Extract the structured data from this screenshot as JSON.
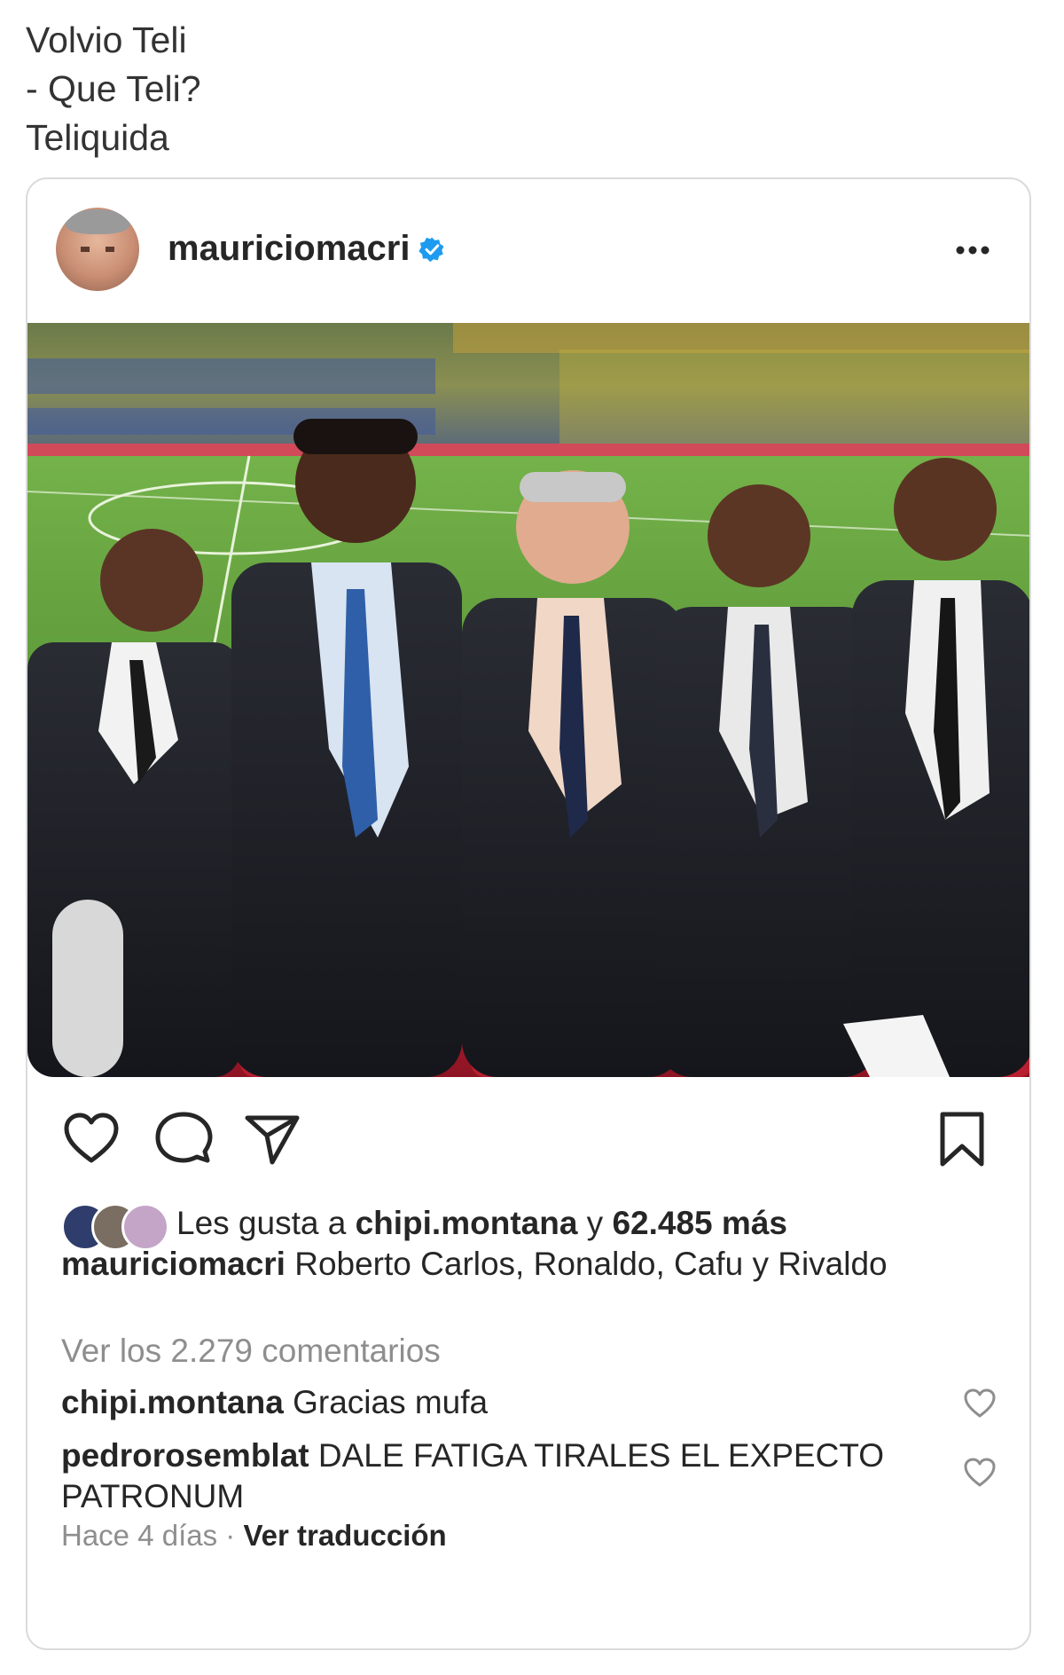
{
  "caption_lines": [
    "Volvio Teli",
    "- Que Teli?",
    "Teliquida"
  ],
  "post": {
    "username": "mauriciomacri",
    "verified_icon": "verified-badge-icon",
    "more_icon": "more-options-icon",
    "colors": {
      "verified": "#1d9bf0",
      "text": "#262626",
      "muted": "#8e8e8e",
      "border": "#dbdbdb"
    }
  },
  "actions": {
    "like_icon": "heart-icon",
    "comment_icon": "comment-icon",
    "share_icon": "send-icon",
    "save_icon": "bookmark-icon"
  },
  "likes": {
    "prefix": "Les gusta a ",
    "user": "chipi.montana",
    "middle": " y ",
    "count": "62.485 más"
  },
  "caption_post": {
    "username": "mauriciomacri",
    "text": " Roberto Carlos, Ronaldo, Cafu y Rivaldo"
  },
  "view_comments": "Ver los 2.279 comentarios",
  "comments": [
    {
      "user": "chipi.montana",
      "text": " Gracias mufa"
    },
    {
      "user": "pedrorosemblat",
      "text": " DALE FATIGA TIRALES EL EXPECTO PATRONUM"
    }
  ],
  "footer": {
    "time": "Hace 4 días",
    "separator": " · ",
    "translate": "Ver traducción"
  }
}
